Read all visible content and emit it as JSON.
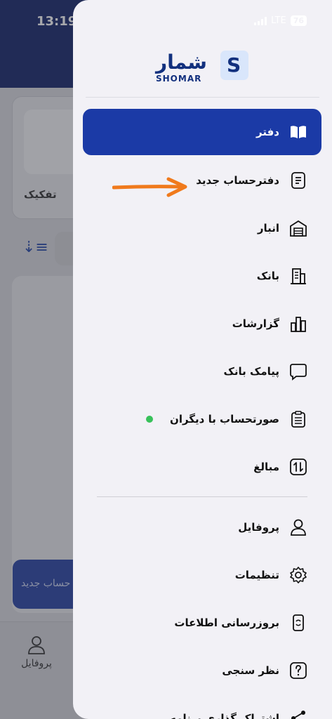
{
  "status_bar": {
    "time": "13:19",
    "network": "LTE",
    "battery": "76"
  },
  "background": {
    "card_label": "تفکیک",
    "new_button": "حساب جدید",
    "tab_profile": "پروفایل"
  },
  "logo": {
    "fa_text": "شمار",
    "en_text": "SHOMAR",
    "mark": "S"
  },
  "menu": {
    "items": [
      {
        "label": "دفتر",
        "icon": "book-icon"
      },
      {
        "label": "دفترحساب جدید",
        "icon": "new-ledger-icon"
      },
      {
        "label": "انبار",
        "icon": "warehouse-icon"
      },
      {
        "label": "بانک",
        "icon": "bank-building-icon"
      },
      {
        "label": "گزارشات",
        "icon": "chart-icon"
      },
      {
        "label": "پیامک بانک",
        "icon": "message-icon"
      },
      {
        "label": "صورتحساب با دیگران",
        "icon": "clipboard-icon"
      },
      {
        "label": "مبالغ",
        "icon": "transfer-icon"
      },
      {
        "label": "پروفایل",
        "icon": "user-icon"
      },
      {
        "label": "تنظیمات",
        "icon": "gear-icon"
      },
      {
        "label": "بروزرسانی اطلاعات",
        "icon": "sync-icon"
      },
      {
        "label": "نظر سنجی",
        "icon": "question-icon"
      },
      {
        "label": "اشتراک گذاری برنامه",
        "icon": "share-icon"
      }
    ]
  },
  "colors": {
    "accent": "#1b3aa6",
    "brand": "#12307e",
    "arrow": "#f07a1c",
    "online_dot": "#38c15a"
  }
}
